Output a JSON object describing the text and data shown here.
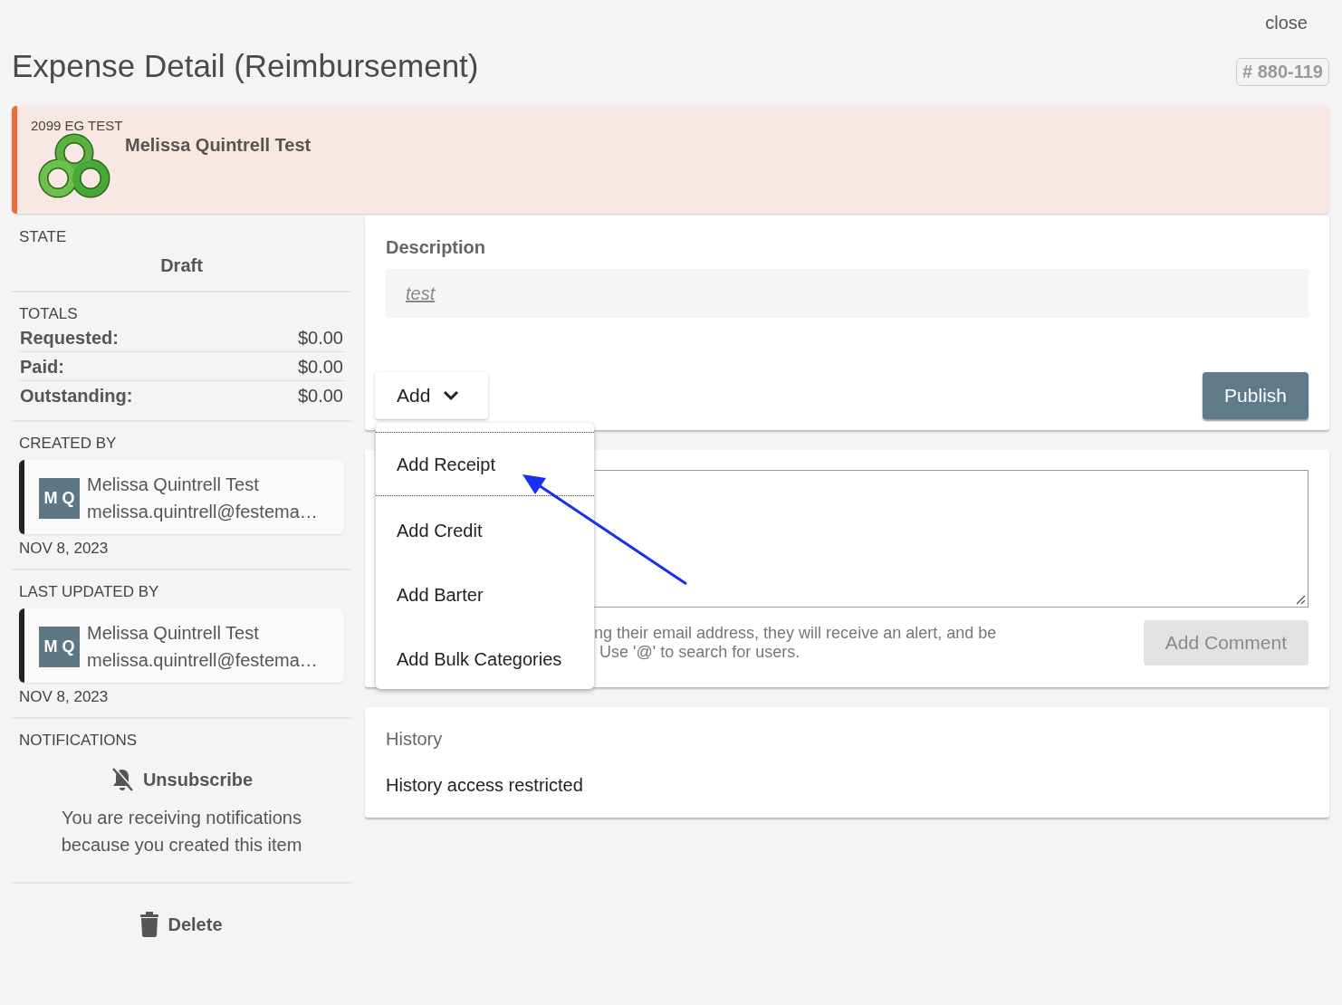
{
  "header": {
    "close": "close",
    "title": "Expense Detail (Reimbursement)",
    "number": "# 880-119"
  },
  "banner": {
    "org": "2099 EG TEST",
    "name": "Melissa Quintrell Test"
  },
  "state": {
    "label": "STATE",
    "value": "Draft"
  },
  "totals": {
    "label": "TOTALS",
    "rows": [
      {
        "label": "Requested:",
        "value": "$0.00"
      },
      {
        "label": "Paid:",
        "value": "$0.00"
      },
      {
        "label": "Outstanding:",
        "value": "$0.00"
      }
    ]
  },
  "people": [
    {
      "label": "CREATED BY",
      "initials": "M Q",
      "name": "Melissa Quintrell Test",
      "email": "melissa.quintrell@festema…",
      "date": "NOV 8, 2023"
    },
    {
      "label": "LAST UPDATED BY",
      "initials": "M Q",
      "name": "Melissa Quintrell Test",
      "email": "melissa.quintrell@festema…",
      "date": "NOV 8, 2023"
    }
  ],
  "notifications": {
    "label": "NOTIFICATIONS",
    "action": "Unsubscribe",
    "text": "You are receiving notifications because you created this item"
  },
  "delete": "Delete",
  "description": {
    "label": "Description",
    "value": "test"
  },
  "add_button": "Add",
  "publish": "Publish",
  "menu": [
    {
      "label": "Add Receipt",
      "selected": true
    },
    {
      "label": "Add Credit",
      "selected": false
    },
    {
      "label": "Add Barter",
      "selected": false
    },
    {
      "label": "Add Bulk Categories",
      "selected": false
    }
  ],
  "comment": {
    "hint": [
      "ng their email address, they will receive an alert, and be",
      "Use '@' to search for users."
    ],
    "button": "Add Comment",
    "disabled": true
  },
  "history": {
    "label": "History",
    "text": "History access restricted"
  }
}
